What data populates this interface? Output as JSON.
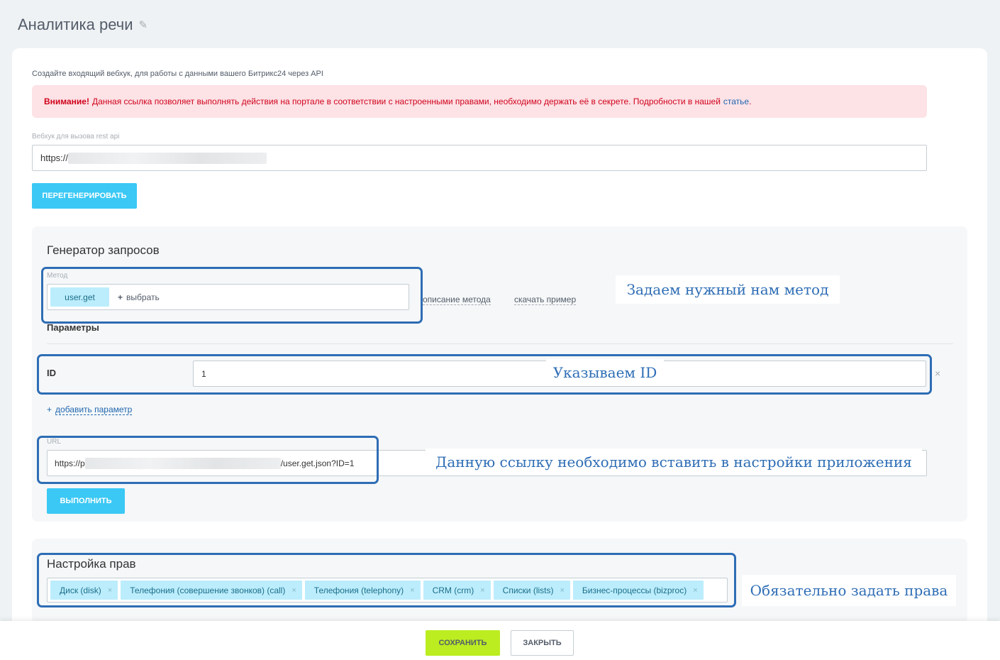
{
  "page": {
    "title": "Аналитика речи"
  },
  "intro_text": "Создайте входящий вебхук, для работы с данными вашего Битрикс24 через API",
  "alert": {
    "bold": "Внимание!",
    "text": "Данная ссылка позволяет выполнять действия на портале в соответствии с настроенными правами, необходимо держать её в секрете. Подробности в нашей",
    "link": "статье",
    "tail": "."
  },
  "webhook": {
    "label": "Вебхук для вызова rest api",
    "value_prefix": "https://"
  },
  "regenerate_button": "ПЕРЕГЕНЕРИРОВАТЬ",
  "generator": {
    "title": "Генератор запросов",
    "method_label": "Метод",
    "method_value": "user.get",
    "choose_plus": "+",
    "choose_label": "выбрать",
    "description_link": "описание метода",
    "example_link": "скачать пример",
    "params_title": "Параметры",
    "param": {
      "name": "ID",
      "value": "1"
    },
    "remove_symbol": "×",
    "add_param_plus": "+",
    "add_param_label": "добавить параметр",
    "url_label": "URL",
    "url_prefix": "https://p",
    "url_suffix": "/user.get.json?ID=1",
    "run_button": "ВЫПОЛНИТЬ"
  },
  "rights": {
    "title": "Настройка прав",
    "scopes": [
      "Диск (disk)",
      "Телефония (совершение звонков) (call)",
      "Телефония (telephony)",
      "CRM (crm)",
      "Списки (lists)",
      "Бизнес-процессы (bizproc)"
    ],
    "remove_symbol": "×"
  },
  "annotations": {
    "method": "Задаем нужный нам метод",
    "param": "Указываем ID",
    "url": "Данную ссылку необходимо вставить в настройки приложения",
    "rights": "Обязательно задать права"
  },
  "footer": {
    "save": "СОХРАНИТЬ",
    "close": "ЗАКРЫТЬ"
  },
  "colors": {
    "accent_blue": "#3bc8f5",
    "save_green": "#bbed21",
    "alert_bg": "#fde2e6",
    "alert_text": "#d0021b",
    "annotation_blue": "#2e6db5"
  }
}
